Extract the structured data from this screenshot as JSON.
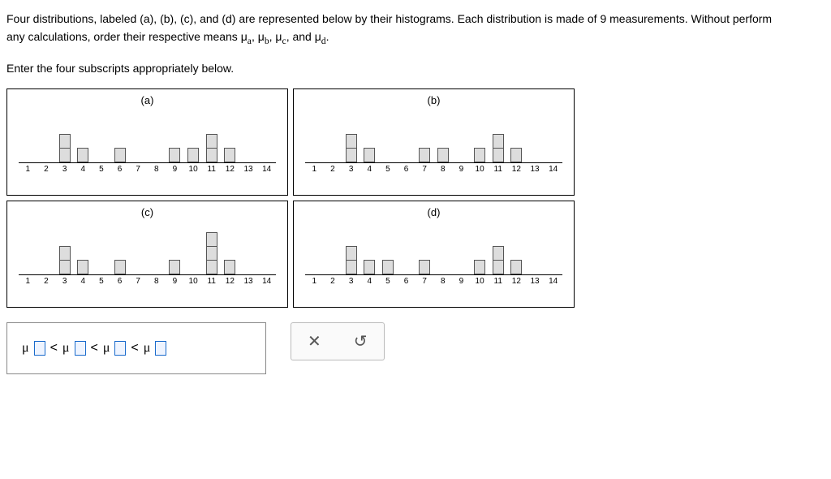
{
  "instructions": {
    "line1": "Four distributions, labeled (a), (b), (c), and (d) are represented below by their histograms. Each distribution is made of 9 measurements. Without perform",
    "line2": "any calculations, order their respective means μ",
    "sub_a": "a",
    "comma1": ", μ",
    "sub_b": "b",
    "comma2": ", μ",
    "sub_c": "c",
    "andtxt": ", and μ",
    "sub_d": "d",
    "dot": ".",
    "line3": "Enter the four subscripts appropriately below."
  },
  "labels": {
    "a": "(a)",
    "b": "(b)",
    "c": "(c)",
    "d": "(d)"
  },
  "axis": [
    "1",
    "2",
    "3",
    "4",
    "5",
    "6",
    "7",
    "8",
    "9",
    "10",
    "11",
    "12",
    "13",
    "14"
  ],
  "answer": {
    "mu": "μ",
    "lt": "<"
  },
  "controls": {
    "clear": "✕",
    "reset": "↺"
  },
  "chart_data": [
    {
      "type": "bar",
      "title": "(a)",
      "xlabel": "",
      "ylabel": "",
      "ylim": [
        0,
        3
      ],
      "categories": [
        1,
        2,
        3,
        4,
        5,
        6,
        7,
        8,
        9,
        10,
        11,
        12,
        13,
        14
      ],
      "values": [
        0,
        0,
        2,
        1,
        0,
        1,
        0,
        0,
        1,
        1,
        2,
        1,
        0,
        0
      ]
    },
    {
      "type": "bar",
      "title": "(b)",
      "xlabel": "",
      "ylabel": "",
      "ylim": [
        0,
        3
      ],
      "categories": [
        1,
        2,
        3,
        4,
        5,
        6,
        7,
        8,
        9,
        10,
        11,
        12,
        13,
        14
      ],
      "values": [
        0,
        0,
        2,
        1,
        0,
        0,
        1,
        1,
        0,
        1,
        2,
        1,
        0,
        0
      ]
    },
    {
      "type": "bar",
      "title": "(c)",
      "xlabel": "",
      "ylabel": "",
      "ylim": [
        0,
        3
      ],
      "categories": [
        1,
        2,
        3,
        4,
        5,
        6,
        7,
        8,
        9,
        10,
        11,
        12,
        13,
        14
      ],
      "values": [
        0,
        0,
        2,
        1,
        0,
        1,
        0,
        0,
        1,
        0,
        3,
        1,
        0,
        0
      ]
    },
    {
      "type": "bar",
      "title": "(d)",
      "xlabel": "",
      "ylabel": "",
      "ylim": [
        0,
        3
      ],
      "categories": [
        1,
        2,
        3,
        4,
        5,
        6,
        7,
        8,
        9,
        10,
        11,
        12,
        13,
        14
      ],
      "values": [
        0,
        0,
        2,
        1,
        1,
        0,
        1,
        0,
        0,
        1,
        2,
        1,
        0,
        0
      ]
    }
  ]
}
